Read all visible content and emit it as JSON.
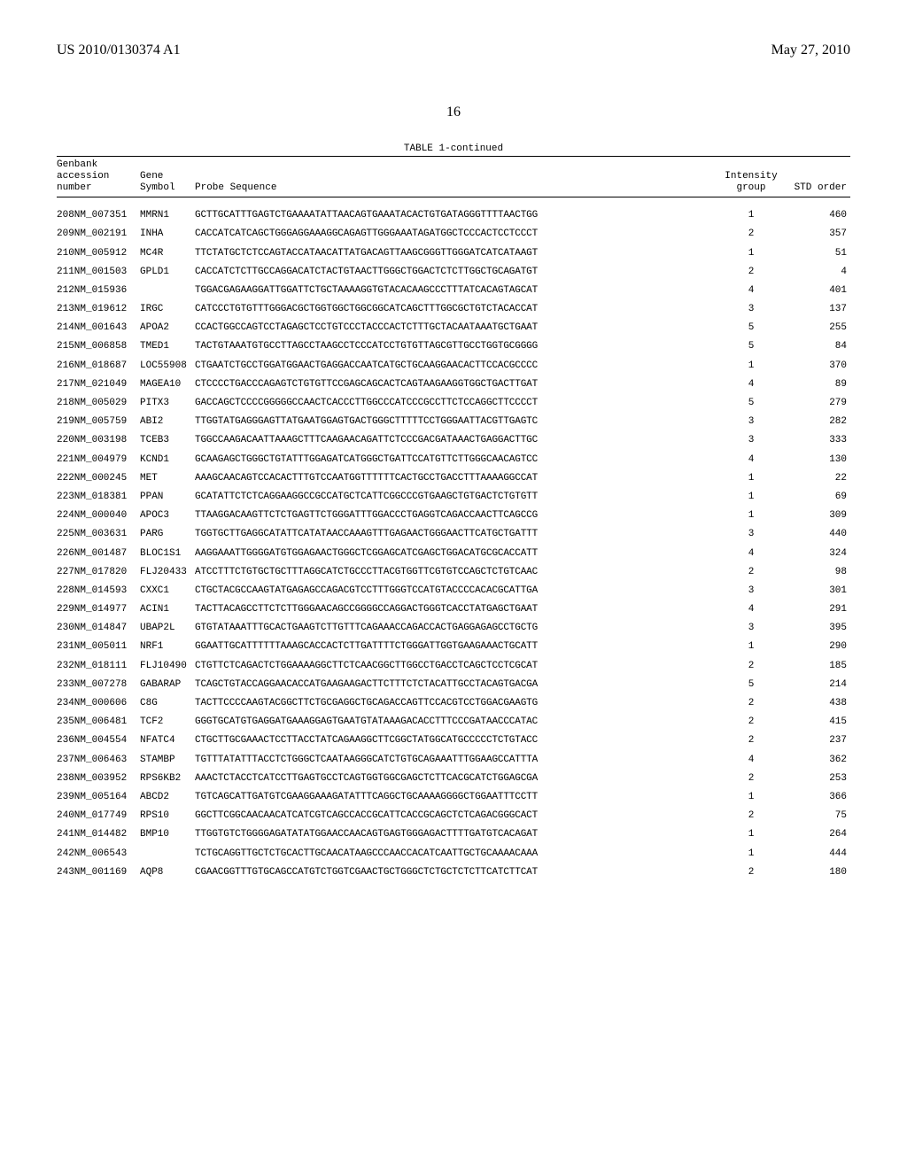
{
  "header": {
    "pubnum": "US 2010/0130374 A1",
    "pubdate": "May 27, 2010"
  },
  "page_number": "16",
  "table_caption": "TABLE 1-continued",
  "table_headers": {
    "accession_label_line1": "Genbank",
    "accession_label_line2": "accession",
    "accession_label_line3": "number",
    "gene_label_line1": "Gene",
    "gene_label_line2": "Symbol",
    "probe_label": "Probe Sequence",
    "intensity_label_line1": "Intensity",
    "intensity_label_line2": "group",
    "std_label": "STD order"
  },
  "rows": [
    {
      "idx": 208,
      "acc": "NM_007351",
      "gene": "MMRN1",
      "probe": "GCTTGCATTTGAGTCTGAAAATATTAACAGTGAAATACACTGTGATAGGGTTTTAACTGG",
      "intensity": 1,
      "std": 460
    },
    {
      "idx": 209,
      "acc": "NM_002191",
      "gene": "INHA",
      "probe": "CACCATCATCAGCTGGGAGGAAAGGCAGAGTTGGGAAATAGATGGCTCCCACTCCTCCCT",
      "intensity": 2,
      "std": 357
    },
    {
      "idx": 210,
      "acc": "NM_005912",
      "gene": "MC4R",
      "probe": "TTCTATGCTCTCCAGTACCATAACATTATGACAGTTAAGCGGGTTGGGATCATCATAAGT",
      "intensity": 1,
      "std": 51
    },
    {
      "idx": 211,
      "acc": "NM_001503",
      "gene": "GPLD1",
      "probe": "CACCATCTCTTGCCAGGACATCTACTGTAACTTGGGCTGGACTCTCTTGGCTGCAGATGT",
      "intensity": 2,
      "std": 4
    },
    {
      "idx": 212,
      "acc": "NM_015936",
      "gene": "",
      "probe": "TGGACGAGAAGGATTGGATTCTGCTAAAAGGTGTACACAAGCCCTTTATCACAGTAGCAT",
      "intensity": 4,
      "std": 401
    },
    {
      "idx": 213,
      "acc": "NM_019612",
      "gene": "IRGC",
      "probe": "CATCCCTGTGTTTGGGACGCTGGTGGCTGGCGGCATCAGCTTTGGCGCTGTCTACACCAT",
      "intensity": 3,
      "std": 137
    },
    {
      "idx": 214,
      "acc": "NM_001643",
      "gene": "APOA2",
      "probe": "CCACTGGCCAGTCCTAGAGCTCCTGTCCCTACCCACTCTTTGCTACAATAAATGCTGAAT",
      "intensity": 5,
      "std": 255
    },
    {
      "idx": 215,
      "acc": "NM_006858",
      "gene": "TMED1",
      "probe": "TACTGTAAATGTGCCTTAGCCTAAGCCTCCCATCCTGTGTTAGCGTTGCCTGGTGCGGGG",
      "intensity": 5,
      "std": 84
    },
    {
      "idx": 216,
      "acc": "NM_018687",
      "gene": "LOC55908",
      "probe": "CTGAATCTGCCTGGATGGAACTGAGGACCAATCATGCTGCAAGGAACACTTCCACGCCCC",
      "intensity": 1,
      "std": 370
    },
    {
      "idx": 217,
      "acc": "NM_021049",
      "gene": "MAGEA10",
      "probe": "CTCCCCTGACCCAGAGTCTGTGTTCCGAGCAGCACTCAGTAAGAAGGTGGCTGACTTGAT",
      "intensity": 4,
      "std": 89
    },
    {
      "idx": 218,
      "acc": "NM_005029",
      "gene": "PITX3",
      "probe": "GACCAGCTCCCCGGGGGCCAACTCACCCTTGGCCCATCCCGCCTTCTCCAGGCTTCCCCT",
      "intensity": 5,
      "std": 279
    },
    {
      "idx": 219,
      "acc": "NM_005759",
      "gene": "ABI2",
      "probe": "TTGGTATGAGGGAGTTATGAATGGAGTGACTGGGCTTTTTCCTGGGAATTACGTTGAGTC",
      "intensity": 3,
      "std": 282
    },
    {
      "idx": 220,
      "acc": "NM_003198",
      "gene": "TCEB3",
      "probe": "TGGCCAAGACAATTAAAGCTTTCAAGAACAGATTCTCCCGACGATAAACTGAGGACTTGC",
      "intensity": 3,
      "std": 333
    },
    {
      "idx": 221,
      "acc": "NM_004979",
      "gene": "KCND1",
      "probe": "GCAAGAGCTGGGCTGTATTTGGAGATCATGGGCTGATTCCATGTTCTTGGGCAACAGTCC",
      "intensity": 4,
      "std": 130
    },
    {
      "idx": 222,
      "acc": "NM_000245",
      "gene": "MET",
      "probe": "AAAGCAACAGTCCACACTTTGTCCAATGGTTTTTTCACTGCCTGACCTTTAAAAGGCCAT",
      "intensity": 1,
      "std": 22
    },
    {
      "idx": 223,
      "acc": "NM_018381",
      "gene": "PPAN",
      "probe": "GCATATTCTCTCAGGAAGGCCGCCATGCTCATTCGGCCCGTGAAGCTGTGACTCTGTGTT",
      "intensity": 1,
      "std": 69
    },
    {
      "idx": 224,
      "acc": "NM_000040",
      "gene": "APOC3",
      "probe": "TTAAGGACAAGTTCTCTGAGTTCTGGGATTTGGACCCTGAGGTCAGACCAACTTCAGCCG",
      "intensity": 1,
      "std": 309
    },
    {
      "idx": 225,
      "acc": "NM_003631",
      "gene": "PARG",
      "probe": "TGGTGCTTGAGGCATATTCATATAACCAAAGTTTGAGAACTGGGAACTTCATGCTGATTT",
      "intensity": 3,
      "std": 440
    },
    {
      "idx": 226,
      "acc": "NM_001487",
      "gene": "BLOC1S1",
      "probe": "AAGGAAATTGGGGATGTGGAGAACTGGGCTCGGAGCATCGAGCTGGACATGCGCACCATT",
      "intensity": 4,
      "std": 324
    },
    {
      "idx": 227,
      "acc": "NM_017820",
      "gene": "FLJ20433",
      "probe": "ATCCTTTCTGTGCTGCTTTAGGCATCTGCCCTTACGTGGTTCGTGTCCAGCTCTGTCAAC",
      "intensity": 2,
      "std": 98
    },
    {
      "idx": 228,
      "acc": "NM_014593",
      "gene": "CXXC1",
      "probe": "CTGCTACGCCAAGTATGAGAGCCAGACGTCCTTTGGGTCCATGTACCCCACACGCATTGA",
      "intensity": 3,
      "std": 301
    },
    {
      "idx": 229,
      "acc": "NM_014977",
      "gene": "ACIN1",
      "probe": "TACTTACAGCCTTCTCTTGGGAACAGCCGGGGCCAGGACTGGGTCACCTATGAGCTGAAT",
      "intensity": 4,
      "std": 291
    },
    {
      "idx": 230,
      "acc": "NM_014847",
      "gene": "UBAP2L",
      "probe": "GTGTATAAATTTGCACTGAAGTCTTGTTTCAGAAACCAGACCACTGAGGAGAGCCTGCTG",
      "intensity": 3,
      "std": 395
    },
    {
      "idx": 231,
      "acc": "NM_005011",
      "gene": "NRF1",
      "probe": "GGAATTGCATTTTTTAAAGCACCACTCTTGATTTTCTGGGATTGGTGAAGAAACTGCATT",
      "intensity": 1,
      "std": 290
    },
    {
      "idx": 232,
      "acc": "NM_018111",
      "gene": "FLJ10490",
      "probe": "CTGTTCTCAGACTCTGGAAAAGGCTTCTCAACGGCTTGGCCTGACCTCAGCTCCTCGCAT",
      "intensity": 2,
      "std": 185
    },
    {
      "idx": 233,
      "acc": "NM_007278",
      "gene": "GABARAP",
      "probe": "TCAGCTGTACCAGGAACACCATGAAGAAGACTTCTTTCTCTACATTGCCTACAGTGACGA",
      "intensity": 5,
      "std": 214
    },
    {
      "idx": 234,
      "acc": "NM_000606",
      "gene": "C8G",
      "probe": "TACTTCCCCAAGTACGGCTTCTGCGAGGCTGCAGACCAGTTCCACGTCCTGGACGAAGTG",
      "intensity": 2,
      "std": 438
    },
    {
      "idx": 235,
      "acc": "NM_006481",
      "gene": "TCF2",
      "probe": "GGGTGCATGTGAGGATGAAAGGAGTGAATGTATAAAGACACCTTTCCCGATAACCCATAC",
      "intensity": 2,
      "std": 415
    },
    {
      "idx": 236,
      "acc": "NM_004554",
      "gene": "NFATC4",
      "probe": "CTGCTTGCGAAACTCCTTACCTATCAGAAGGCTTCGGCTATGGCATGCCCCCTCTGTACC",
      "intensity": 2,
      "std": 237
    },
    {
      "idx": 237,
      "acc": "NM_006463",
      "gene": "STAMBP",
      "probe": "TGTTTATATTTACCTCTGGGCTCAATAAGGGCATCTGTGCAGAAATTTGGAAGCCATTTA",
      "intensity": 4,
      "std": 362
    },
    {
      "idx": 238,
      "acc": "NM_003952",
      "gene": "RPS6KB2",
      "probe": "AAACTCTACCTCATCCTTGAGTGCCTCAGTGGTGGCGAGCTCTTCACGCATCTGGAGCGA",
      "intensity": 2,
      "std": 253
    },
    {
      "idx": 239,
      "acc": "NM_005164",
      "gene": "ABCD2",
      "probe": "TGTCAGCATTGATGTCGAAGGAAAGATATTTCAGGCTGCAAAAGGGGCTGGAATTTCCTT",
      "intensity": 1,
      "std": 366
    },
    {
      "idx": 240,
      "acc": "NM_017749",
      "gene": "RPS10",
      "probe": "GGCTTCGGCAACAACATCATCGTCAGCCACCGCATTCACCGCAGCTCTCAGACGGGCACT",
      "intensity": 2,
      "std": 75
    },
    {
      "idx": 241,
      "acc": "NM_014482",
      "gene": "BMP10",
      "probe": "TTGGTGTCTGGGGAGATATATGGAACCAACAGTGAGTGGGAGACTTTTGATGTCACAGAT",
      "intensity": 1,
      "std": 264
    },
    {
      "idx": 242,
      "acc": "NM_006543",
      "gene": "",
      "probe": "TCTGCAGGTTGCTCTGCACTTGCAACATAAGCCCAACCACATCAATTGCTGCAAAACAAA",
      "intensity": 1,
      "std": 444
    },
    {
      "idx": 243,
      "acc": "NM_001169",
      "gene": "AQP8",
      "probe": "CGAACGGTTTGTGCAGCCATGTCTGGTCGAACTGCTGGGCTCTGCTCTCTTCATCTTCAT",
      "intensity": 2,
      "std": 180
    }
  ]
}
